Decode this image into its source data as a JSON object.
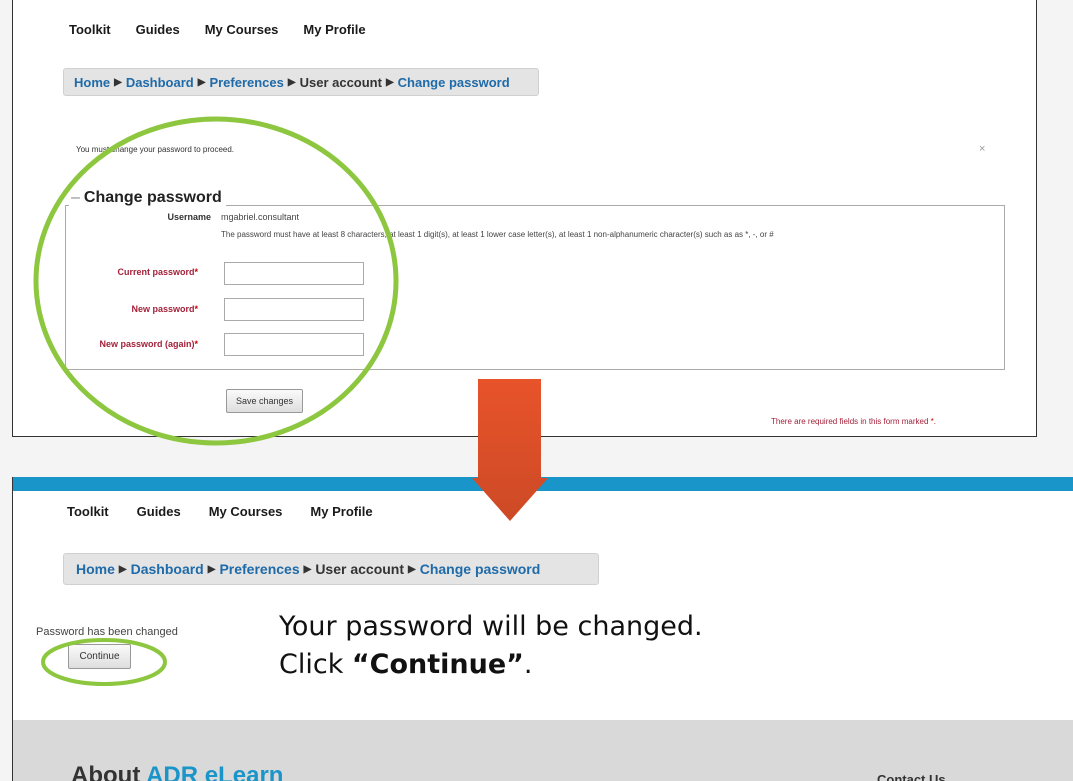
{
  "top": {
    "nav": [
      "Toolkit",
      "Guides",
      "My Courses",
      "My Profile"
    ],
    "breadcrumb": [
      {
        "label": "Home",
        "link": true
      },
      {
        "label": "Dashboard",
        "link": true
      },
      {
        "label": "Preferences",
        "link": true
      },
      {
        "label": "User account",
        "link": false
      },
      {
        "label": "Change password",
        "link": true
      }
    ],
    "breadcrumb_sep": "▶",
    "notice": "You must change your password to proceed.",
    "close": "×",
    "legend": "Change password",
    "username_label": "Username",
    "username_value": "mgabriel.consultant",
    "password_rule": "The password must have at least 8 characters, at least 1 digit(s), at least 1 lower case letter(s), at least 1 non-alphanumeric character(s) such as as *, -, or #",
    "fields": [
      {
        "label": "Current password",
        "value": ""
      },
      {
        "label": "New password",
        "value": ""
      },
      {
        "label": "New password (again)",
        "value": ""
      }
    ],
    "required_mark": "*",
    "save_label": "Save changes",
    "required_note": "There are required fields in this form marked",
    "required_note_mark": "*."
  },
  "bottom": {
    "nav": [
      "Toolkit",
      "Guides",
      "My Courses",
      "My Profile"
    ],
    "breadcrumb": [
      {
        "label": "Home",
        "link": true
      },
      {
        "label": "Dashboard",
        "link": true
      },
      {
        "label": "Preferences",
        "link": true
      },
      {
        "label": "User account",
        "link": false
      },
      {
        "label": "Change password",
        "link": true
      }
    ],
    "breadcrumb_sep": "▶",
    "message": "Password has been changed",
    "continue_label": "Continue",
    "footer_title_prefix": "About ",
    "footer_title_brand": "ADR eLearn",
    "footer_contact": "Contact Us"
  },
  "instruction": {
    "line1": "Your password will be changed.",
    "line2_prefix": "Click ",
    "line2_bold": "“Continue”",
    "line2_suffix": "."
  },
  "colors": {
    "highlight": "#8dc63f",
    "arrow_top": "#e8532a",
    "arrow_bottom": "#cc4a26",
    "brand_blue": "#1a95c9",
    "link": "#1f6aa8"
  }
}
